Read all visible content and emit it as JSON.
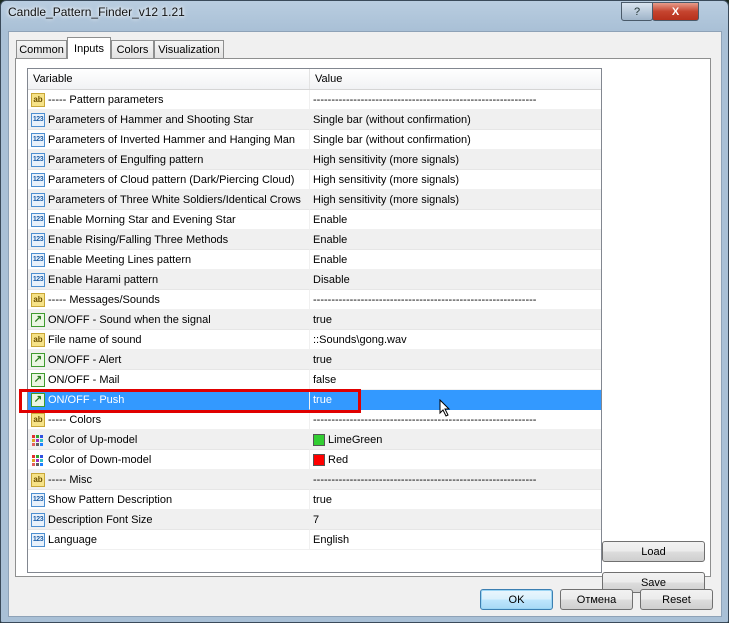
{
  "window": {
    "title": "Candle_Pattern_Finder_v12 1.21",
    "help_glyph": "?",
    "close_glyph": "X"
  },
  "tabs": [
    {
      "label": "Common"
    },
    {
      "label": "Inputs"
    },
    {
      "label": "Colors"
    },
    {
      "label": "Visualization"
    }
  ],
  "table": {
    "col_variable": "Variable",
    "col_value": "Value",
    "rows": [
      {
        "type": "ab",
        "name": "----- Pattern parameters",
        "value": "-------------------------------------------------------------"
      },
      {
        "type": "num",
        "name": "Parameters of Hammer and Shooting Star",
        "value": "Single bar (without confirmation)"
      },
      {
        "type": "num",
        "name": "Parameters of Inverted Hammer and Hanging Man",
        "value": "Single bar (without confirmation)"
      },
      {
        "type": "num",
        "name": "Parameters of Engulfing pattern",
        "value": "High sensitivity (more signals)"
      },
      {
        "type": "num",
        "name": "Parameters of Cloud pattern (Dark/Piercing Cloud)",
        "value": "High sensitivity (more signals)"
      },
      {
        "type": "num",
        "name": "Parameters of Three White Soldiers/Identical Crows",
        "value": "High sensitivity (more signals)"
      },
      {
        "type": "num",
        "name": "Enable Morning Star and Evening Star",
        "value": "Enable"
      },
      {
        "type": "num",
        "name": "Enable Rising/Falling Three Methods",
        "value": "Enable"
      },
      {
        "type": "num",
        "name": "Enable Meeting Lines pattern",
        "value": "Enable"
      },
      {
        "type": "num",
        "name": "Enable Harami pattern",
        "value": "Disable"
      },
      {
        "type": "ab",
        "name": "----- Messages/Sounds",
        "value": "-------------------------------------------------------------"
      },
      {
        "type": "bool",
        "name": "ON/OFF - Sound when the signal",
        "value": "true"
      },
      {
        "type": "ab",
        "name": "File name of sound",
        "value": "::Sounds\\gong.wav"
      },
      {
        "type": "bool",
        "name": "ON/OFF - Alert",
        "value": "true"
      },
      {
        "type": "bool",
        "name": "ON/OFF - Mail",
        "value": "false"
      },
      {
        "type": "bool",
        "name": "ON/OFF - Push",
        "value": "true",
        "selected": true
      },
      {
        "type": "ab",
        "name": "----- Colors",
        "value": "-------------------------------------------------------------"
      },
      {
        "type": "color",
        "name": "Color of Up-model",
        "value": "LimeGreen",
        "swatch": "#32cd32"
      },
      {
        "type": "color",
        "name": "Color of Down-model",
        "value": "Red",
        "swatch": "#ff0000"
      },
      {
        "type": "ab",
        "name": "----- Misc",
        "value": "-------------------------------------------------------------"
      },
      {
        "type": "num",
        "name": "Show Pattern Description",
        "value": "true"
      },
      {
        "type": "num",
        "name": "Description Font Size",
        "value": "7"
      },
      {
        "type": "num",
        "name": "Language",
        "value": "English"
      }
    ]
  },
  "icons": {
    "ab": "ab",
    "num": "123",
    "bool": "↗"
  },
  "side_buttons": {
    "load": "Load",
    "save": "Save"
  },
  "footer_buttons": {
    "ok": "OK",
    "cancel": "Отмена",
    "reset": "Reset"
  },
  "colors": {
    "selection": "#3399ff",
    "highlight_box": "#e00000"
  }
}
